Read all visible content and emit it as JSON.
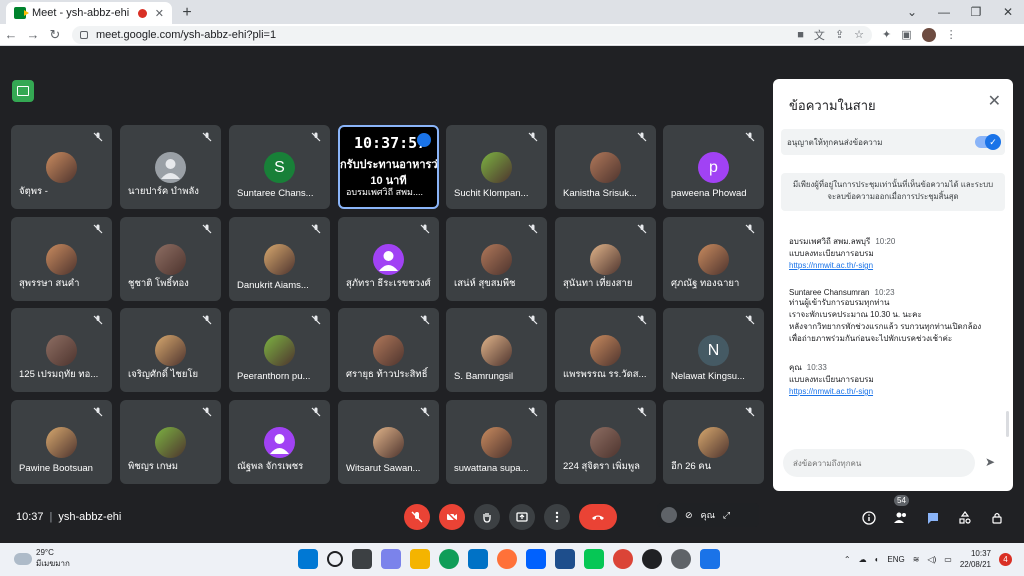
{
  "browser": {
    "tab_title": "Meet - ysh-abbz-ehi",
    "url": "meet.google.com/ysh-abbz-ehi?pli=1"
  },
  "participants": [
    {
      "name": "จัตุพร -",
      "avatar": "photo",
      "letter": ""
    },
    {
      "name": "นายปาร์ค บำพลัง",
      "avatar": "default",
      "letter": ""
    },
    {
      "name": "Suntaree Chans...",
      "avatar": "letter",
      "letter": "S",
      "color": "#188038"
    },
    {
      "name": "Suchit Klompan...",
      "avatar": "photo",
      "letter": ""
    },
    {
      "name": "Kanistha Srisuk...",
      "avatar": "photo",
      "letter": ""
    },
    {
      "name": "paweena Phowad",
      "avatar": "letter",
      "letter": "p",
      "color": "#a142f4"
    },
    {
      "name": "สุพรรษา สนคำ",
      "avatar": "photo",
      "letter": ""
    },
    {
      "name": "ชูชาติ โพธิ์ทอง",
      "avatar": "photo",
      "letter": ""
    },
    {
      "name": "Danukrit Aiams...",
      "avatar": "photo",
      "letter": ""
    },
    {
      "name": "สุภัทรา ธีระเรขชวงศ์",
      "avatar": "photo-purple",
      "letter": ""
    },
    {
      "name": "เสน่ห์ สุขสมพืช",
      "avatar": "photo",
      "letter": ""
    },
    {
      "name": "สุนันทา เที่ยงสาย",
      "avatar": "photo",
      "letter": ""
    },
    {
      "name": "ศุภณัฐ ทองฉายา",
      "avatar": "photo",
      "letter": ""
    },
    {
      "name": "125 เปรมฤทัย ทอ...",
      "avatar": "photo",
      "letter": ""
    },
    {
      "name": "เจริญศักดิ์ ไชยโย",
      "avatar": "photo",
      "letter": ""
    },
    {
      "name": "Peeranthorn pu...",
      "avatar": "photo",
      "letter": ""
    },
    {
      "name": "ศรายุธ ท้าวประสิทธิ์",
      "avatar": "photo",
      "letter": ""
    },
    {
      "name": "S. Bamrungsil",
      "avatar": "photo",
      "letter": ""
    },
    {
      "name": "แพรพรรณ รร.วัดส...",
      "avatar": "photo",
      "letter": ""
    },
    {
      "name": "Nelawat Kingsu...",
      "avatar": "letter",
      "letter": "N",
      "color": "#455a64"
    },
    {
      "name": "Pawine Bootsuan",
      "avatar": "photo",
      "letter": ""
    },
    {
      "name": "พิชญร เกษม",
      "avatar": "photo",
      "letter": ""
    },
    {
      "name": "ณัฐพล จักรเพชร",
      "avatar": "photo-purple",
      "letter": ""
    },
    {
      "name": "Witsarut Sawan...",
      "avatar": "photo",
      "letter": ""
    },
    {
      "name": "suwattana supa...",
      "avatar": "photo",
      "letter": ""
    },
    {
      "name": "224 สุจิตรา เพิ่มพูล",
      "avatar": "photo",
      "letter": ""
    },
    {
      "name": "อีก 26 คน",
      "avatar": "photo",
      "letter": ""
    }
  ],
  "screen_share": {
    "clock": "10:37:57",
    "message_line1": "กรับประทานอาหารว่า",
    "message_line2": "10 นาที",
    "presenter": "อบรมเพศวิถี สพม...."
  },
  "self_overlay": {
    "label": "คุณ"
  },
  "meeting": {
    "time": "10:37",
    "code": "ysh-abbz-ehi",
    "participant_count": "54"
  },
  "chat": {
    "title": "ข้อความในสาย",
    "toggle_label": "อนุญาตให้ทุกคนส่งข้อความ",
    "notice": "มีเพียงผู้ที่อยู่ในการประชุมเท่านั้นที่เห็นข้อความได้ และระบบจะลบข้อความออกเมื่อการประชุมสิ้นสุด",
    "messages": [
      {
        "sender": "อบรมเพศวิถี สพม.ลพบุรี",
        "time": "10:20",
        "lines": [
          "แบบลงทะเบียนการอบรม"
        ],
        "link": "https://nmwit.ac.th/-sign"
      },
      {
        "sender": "Suntaree Chansumran",
        "time": "10:23",
        "lines": [
          "ท่านผู้เข้ารับการอบรมทุกท่าน",
          "เราจะพักเบรคประมาณ 10.30 น. นะคะ",
          "หลังจากวิทยากรพักช่วงแรกแล้ว รบกวนทุกท่านเปิดกล้อง",
          "เพื่อถ่ายภาพร่วมกันก่อนจะไปพักเบรคช่วงเช้าค่ะ"
        ],
        "link": ""
      },
      {
        "sender": "คุณ",
        "time": "10:33",
        "lines": [
          "แบบลงทะเบียนการอบรม"
        ],
        "link": "https://nmwit.ac.th/-sign"
      }
    ],
    "input_placeholder": "ส่งข้อความถึงทุกคน"
  },
  "taskbar": {
    "temp": "29°C",
    "weather": "มีเมฆมาก",
    "lang": "ENG",
    "clock_time": "10:37",
    "clock_date": "22/08/21",
    "notif_count": "4"
  },
  "colors": {
    "meet_bg": "#202124",
    "tile_bg": "#3c4043",
    "end_call": "#ea4335",
    "accent": "#1a73e8"
  }
}
